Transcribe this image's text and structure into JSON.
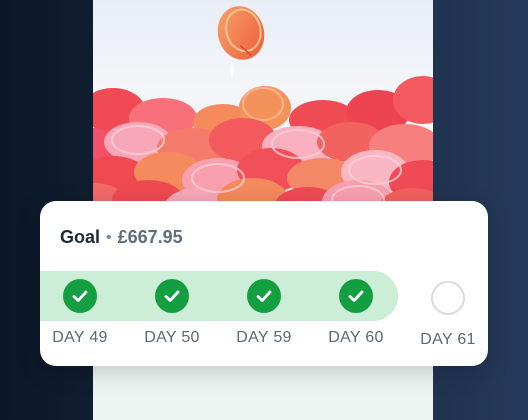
{
  "goal": {
    "label": "Goal",
    "separator": "•",
    "amount": "£667.95"
  },
  "streak": {
    "days": [
      {
        "label": "DAY 49",
        "completed": true
      },
      {
        "label": "DAY 50",
        "completed": true
      },
      {
        "label": "DAY 59",
        "completed": true
      },
      {
        "label": "DAY 60",
        "completed": true
      },
      {
        "label": "DAY 61",
        "completed": false
      }
    ]
  },
  "colors": {
    "check_green": "#149e42",
    "streak_bar": "#cdeed6",
    "coin_red": "#f0505a",
    "coin_orange": "#f58a5c",
    "coin_pink": "#f7a7b8"
  }
}
